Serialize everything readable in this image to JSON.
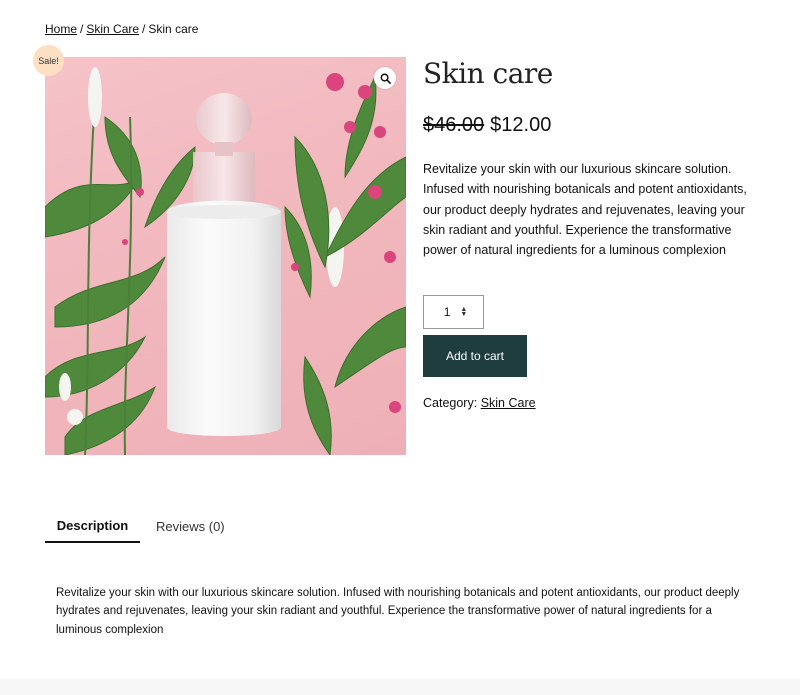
{
  "breadcrumb": {
    "home": "Home",
    "separator": "/",
    "category": "Skin Care",
    "current": "Skin care"
  },
  "badge": {
    "sale": "Sale!"
  },
  "image": {
    "zoom_icon": "magnifier-icon"
  },
  "product": {
    "title": "Skin care",
    "price_old": "$46.00",
    "price_new": "$12.00",
    "short_description": "Revitalize your skin with our luxurious skincare solution. Infused with nourishing botanicals and potent antioxidants, our product deeply hydrates and rejuvenates, leaving your skin radiant and youthful. Experience the transformative power of natural ingredients for a luminous complexion",
    "quantity": "1",
    "add_to_cart_label": "Add to cart",
    "category_label": "Category:",
    "category_value": "Skin Care"
  },
  "tabs": [
    {
      "label": "Description"
    },
    {
      "label": "Reviews (0)"
    }
  ],
  "description": {
    "text": "Revitalize your skin with our luxurious skincare solution. Infused with nourishing botanicals and potent antioxidants, our product deeply hydrates and rejuvenates, leaving your skin radiant and youthful. Experience the transformative power of natural ingredients for a luminous complexion"
  },
  "colors": {
    "button_bg": "#1f3c3e",
    "sale_badge_bg": "#fde0c4",
    "image_bg": "#f2b9bf"
  }
}
